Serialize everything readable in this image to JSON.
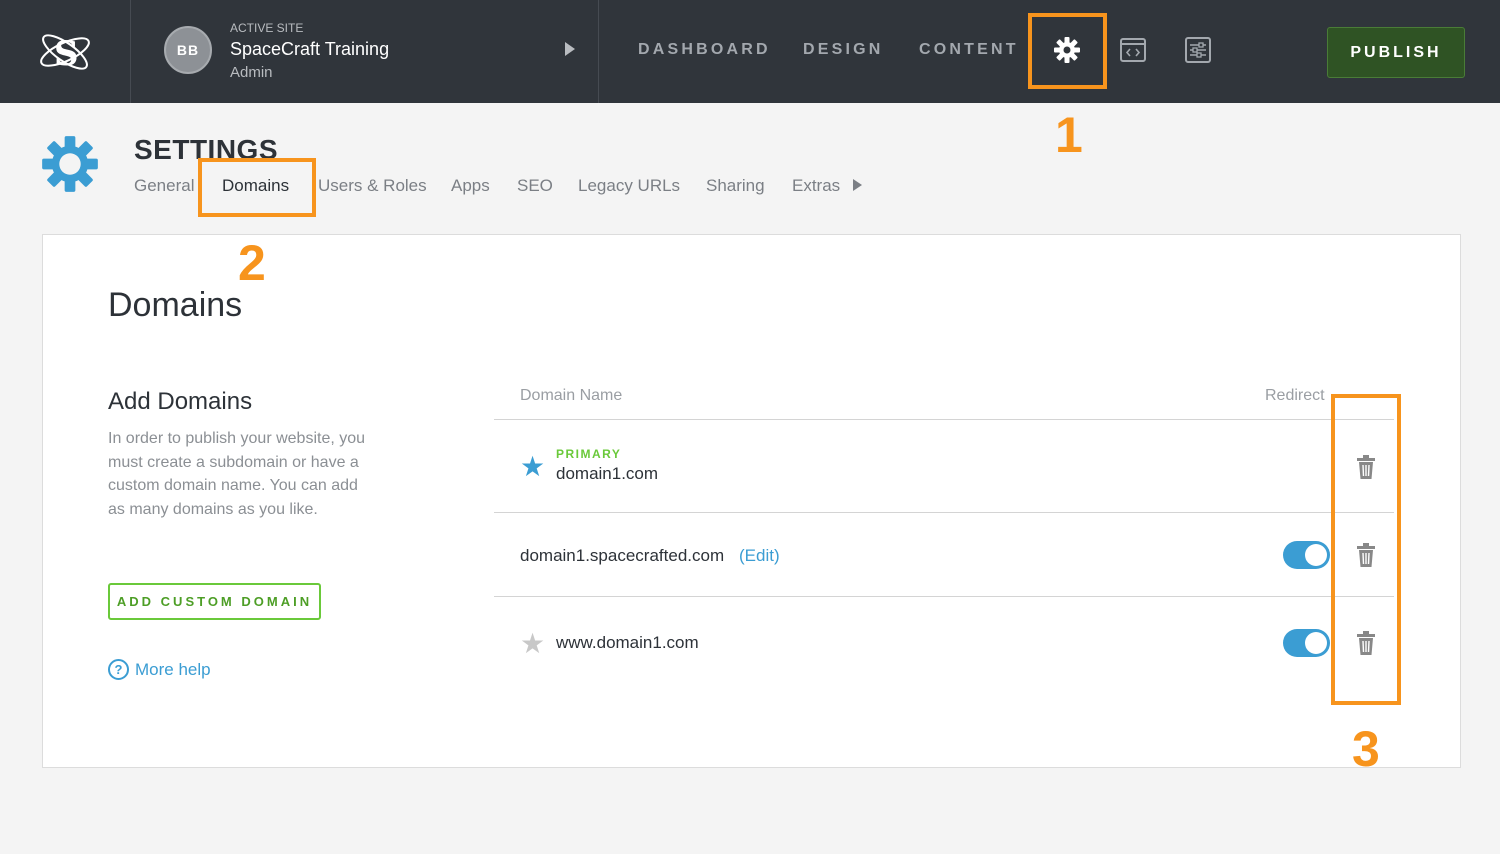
{
  "header": {
    "site_kicker": "ACTIVE SITE",
    "site_name": "SpaceCraft Training",
    "site_role": "Admin",
    "avatar_initials": "BB",
    "nav": [
      "DASHBOARD",
      "DESIGN",
      "CONTENT"
    ],
    "publish_label": "PUBLISH"
  },
  "callouts": [
    "1",
    "2",
    "3"
  ],
  "settings": {
    "title": "SETTINGS",
    "tabs": [
      "General",
      "Domains",
      "Users & Roles",
      "Apps",
      "SEO",
      "Legacy URLs",
      "Sharing",
      "Extras"
    ]
  },
  "panel": {
    "title": "Domains",
    "add_title": "Add Domains",
    "add_description": "In order to publish your website, you must create a subdomain or have a custom domain name. You can add as many domains as you like.",
    "add_button": "ADD CUSTOM DOMAIN",
    "help_label": "More help",
    "help_icon_glyph": "?",
    "columns": {
      "domain": "Domain Name",
      "redirect": "Redirect"
    },
    "rows": [
      {
        "badge": "PRIMARY",
        "domain": "domain1.com",
        "star": "filled",
        "redirect_on": null
      },
      {
        "domain": "domain1.spacecrafted.com",
        "edit_label": "(Edit)",
        "redirect_on": true
      },
      {
        "domain": "www.domain1.com",
        "star": "empty",
        "redirect_on": true
      }
    ]
  },
  "colors": {
    "accent": "#f7941d",
    "brand_blue": "#3b9dd3",
    "green": "#6ac93a",
    "topbar": "#30353b"
  }
}
